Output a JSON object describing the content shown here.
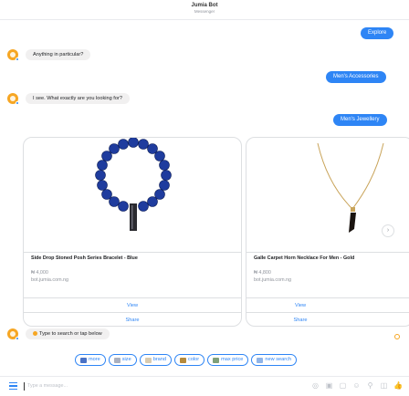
{
  "header": {
    "name": "Jumia Bot",
    "subtitle": "Messenger"
  },
  "messages": {
    "user_1": "Explore",
    "bot_1": "Anything in particular?",
    "user_2": "Men's Accessories",
    "bot_2": "I see. What exactly are you looking for?",
    "user_3": "Men's Jewellery"
  },
  "cards": [
    {
      "title": "Side Drop Stoned Posh Series Bracelet - Blue",
      "price": "₦ 4,000",
      "domain": "bot.jumia.com.ng",
      "view_label": "View",
      "share_label": "Share"
    },
    {
      "title": "Galle Carpet Horn Necklace For Men - Gold",
      "price": "₦ 4,800",
      "domain": "bot.jumia.com.ng",
      "view_label": "View",
      "share_label": "Share"
    }
  ],
  "carousel_next": "›",
  "bot_3": "Type to search or tap below",
  "quick_replies": [
    {
      "label": "more",
      "icon": "more-icon",
      "color": "#4a72c5"
    },
    {
      "label": "size",
      "icon": "size-icon",
      "color": "#aab0bf"
    },
    {
      "label": "brand",
      "icon": "brand-icon",
      "color": "#d9cbb0"
    },
    {
      "label": "color",
      "icon": "color-icon",
      "color": "#b58a3c"
    },
    {
      "label": "max price",
      "icon": "max-price-icon",
      "color": "#7fa07a"
    },
    {
      "label": "new search",
      "icon": "new-search-icon",
      "color": "#8fb4e8"
    }
  ],
  "composer": {
    "placeholder": "Type a message...",
    "tools": [
      "camera-icon",
      "gif-icon",
      "sticker-icon",
      "emoji-icon",
      "location-icon",
      "photo-icon",
      "like-icon"
    ]
  },
  "colors": {
    "accent": "#2e85f5",
    "bot_avatar": "#f6a623",
    "bubble_bot": "#f1f0f0"
  }
}
